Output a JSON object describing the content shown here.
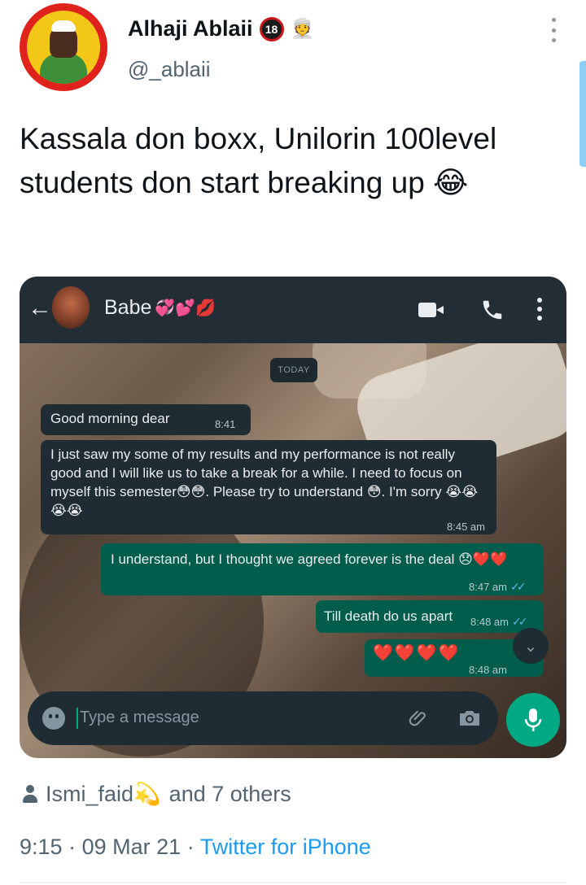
{
  "tweet": {
    "author": {
      "display_name": "Alhaji Ablaii",
      "badge": "18",
      "emoji": "👳",
      "username": "@_ablaii"
    },
    "text": "Kassala don boxx, Unilorin 100level students don start breaking up 😂",
    "liked_by": {
      "name": "Ismi_faid💫",
      "others": "and 7 others"
    },
    "time": "9:15",
    "date": "09 Mar 21",
    "separator": "·",
    "source": "Twitter for iPhone"
  },
  "chat": {
    "contact_name": "Babe",
    "contact_emojis": "💞💕💋",
    "date_divider": "TODAY",
    "messages": [
      {
        "direction": "incoming",
        "text": "Good morning dear",
        "time": "8:41 am"
      },
      {
        "direction": "incoming",
        "text": "I just saw my some of my results and my performance is not really good and I will like us to take a break for a while. I need to focus on myself this semester😳😳. Please try to understand 😳. I'm sorry 😭😭😭😭",
        "time": "8:45 am"
      },
      {
        "direction": "outgoing",
        "text": "I understand, but I thought we agreed forever is the deal 😞❤️❤️",
        "time": "8:47 am"
      },
      {
        "direction": "outgoing",
        "text": "Till death do us apart",
        "time": "8:48 am"
      },
      {
        "direction": "outgoing",
        "text": "❤️❤️❤️❤️",
        "time": "8:48 am"
      }
    ],
    "read_ticks": "✓✓",
    "input_placeholder": "Type a message"
  },
  "icons": {
    "more": "more-vertical-icon",
    "back": "arrow-left-icon",
    "video": "video-call-icon",
    "phone": "phone-icon",
    "emoji": "emoji-icon",
    "attach": "paperclip-icon",
    "camera": "camera-icon",
    "mic": "microphone-icon",
    "scroll_down": "chevron-double-down-icon",
    "person": "person-icon"
  },
  "colors": {
    "link": "#1d9bf0",
    "secondary_text": "#536471",
    "wa_header": "#232d36",
    "wa_incoming": "#202c33",
    "wa_outgoing": "#005c4b",
    "wa_accent": "#00a884"
  }
}
